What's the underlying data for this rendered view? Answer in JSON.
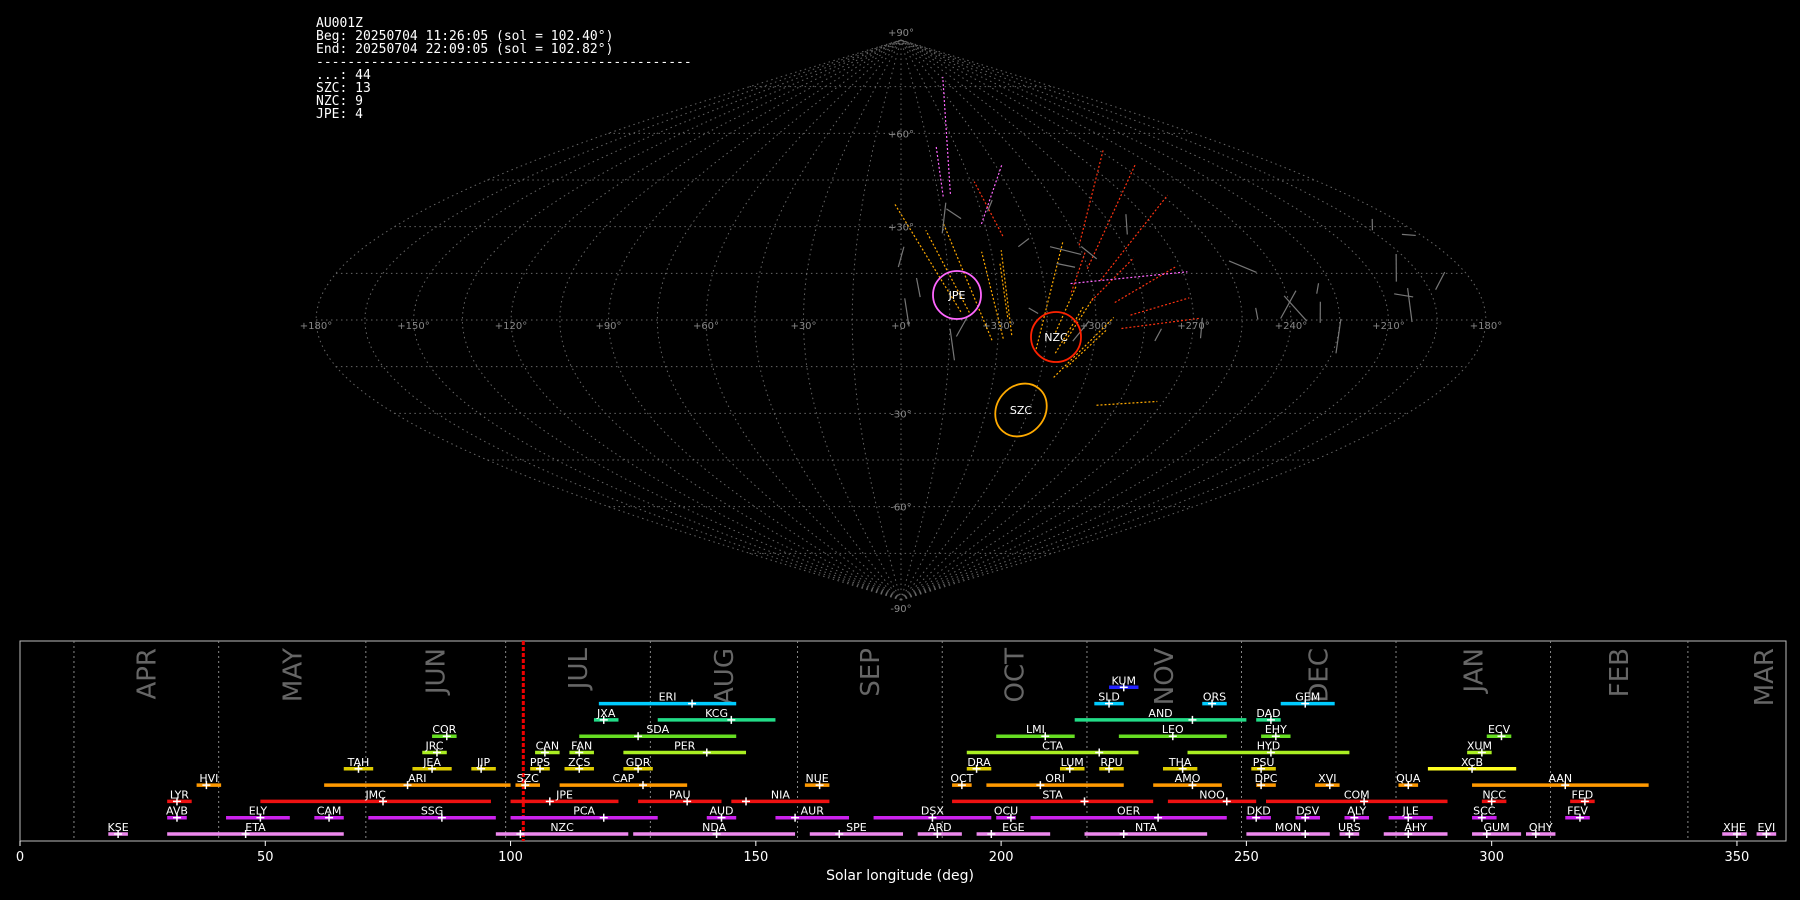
{
  "info": {
    "line1": "AU001Z",
    "line2": "Beg: 20250704 11:26:05 (sol = 102.40°)",
    "line3": "End: 20250704 22:09:05 (sol = 102.82°)",
    "separator": "------------------------------------------------",
    "counts": [
      {
        "label": "...",
        "value": 44
      },
      {
        "label": "SZC",
        "value": 13
      },
      {
        "label": "NZC",
        "value": 9
      },
      {
        "label": "JPE",
        "value": 4
      }
    ]
  },
  "sky": {
    "lon_labels": [
      "+180°",
      "+150°",
      "+120°",
      "+90°",
      "+60°",
      "+30°",
      "+0°",
      "+330°",
      "+300°",
      "+270°",
      "+240°",
      "+210°",
      "+180°"
    ],
    "lat_labels": [
      "+90°",
      "+60°",
      "+30°",
      "-30°",
      "-60°",
      "-90°"
    ],
    "radiants": [
      {
        "code": "JPE",
        "color": "#ff66ff"
      },
      {
        "code": "NZC",
        "color": "#ff2200"
      },
      {
        "code": "SZC",
        "color": "#ffaa00"
      }
    ]
  },
  "chart_data": {
    "type": "timeline",
    "xlabel": "Solar longitude (deg)",
    "xlim": [
      0,
      360
    ],
    "x_ticks": [
      0,
      50,
      100,
      150,
      200,
      250,
      300,
      350
    ],
    "current_sol": 102.6,
    "months": [
      {
        "name": "APR",
        "start": 11,
        "end": 40.5
      },
      {
        "name": "MAY",
        "start": 40.5,
        "end": 70.5
      },
      {
        "name": "JUN",
        "start": 70.5,
        "end": 99
      },
      {
        "name": "JUL",
        "start": 99,
        "end": 128.5
      },
      {
        "name": "AUG",
        "start": 128.5,
        "end": 158.5
      },
      {
        "name": "SEP",
        "start": 158.5,
        "end": 188
      },
      {
        "name": "OCT",
        "start": 188,
        "end": 217.5
      },
      {
        "name": "NOV",
        "start": 217.5,
        "end": 249
      },
      {
        "name": "DEC",
        "start": 249,
        "end": 280.5
      },
      {
        "name": "JAN",
        "start": 280.5,
        "end": 312
      },
      {
        "name": "FEB",
        "start": 312,
        "end": 340
      },
      {
        "name": "MAR",
        "start": 340,
        "end": 371
      }
    ],
    "showers": [
      {
        "code": "KUM",
        "start": 222,
        "end": 228,
        "peak": 225,
        "row": 10,
        "color": "#2222ff"
      },
      {
        "code": "ERI",
        "start": 118,
        "end": 146,
        "peak": 137,
        "row": 9,
        "color": "#00ccff"
      },
      {
        "code": "SLD",
        "start": 219,
        "end": 225,
        "peak": 222,
        "row": 9,
        "color": "#00ccff"
      },
      {
        "code": "ORS",
        "start": 241,
        "end": 246,
        "peak": 243,
        "row": 9,
        "color": "#00ccff"
      },
      {
        "code": "GEM",
        "start": 257,
        "end": 268,
        "peak": 262,
        "row": 9,
        "color": "#00ccff"
      },
      {
        "code": "JXA",
        "start": 117,
        "end": 122,
        "peak": 119,
        "row": 8,
        "color": "#22dd88"
      },
      {
        "code": "KCG",
        "start": 130,
        "end": 154,
        "peak": 145,
        "row": 8,
        "color": "#22dd88"
      },
      {
        "code": "AND",
        "start": 215,
        "end": 250,
        "peak": 239,
        "row": 8,
        "color": "#22dd88"
      },
      {
        "code": "DAD",
        "start": 252,
        "end": 257,
        "peak": 255,
        "row": 8,
        "color": "#22dd88"
      },
      {
        "code": "COR",
        "start": 84,
        "end": 89,
        "peak": 87,
        "row": 7,
        "color": "#66dd22"
      },
      {
        "code": "SDA",
        "start": 114,
        "end": 146,
        "peak": 126,
        "row": 7,
        "color": "#66dd22"
      },
      {
        "code": "LMI",
        "start": 199,
        "end": 215,
        "peak": 209,
        "row": 7,
        "color": "#66dd22"
      },
      {
        "code": "LEO",
        "start": 224,
        "end": 246,
        "peak": 235,
        "row": 7,
        "color": "#66dd22"
      },
      {
        "code": "EHY",
        "start": 253,
        "end": 259,
        "peak": 256,
        "row": 7,
        "color": "#66dd22"
      },
      {
        "code": "ECV",
        "start": 299,
        "end": 304,
        "peak": 302,
        "row": 7,
        "color": "#66dd22"
      },
      {
        "code": "JRC",
        "start": 82,
        "end": 87,
        "peak": 85,
        "row": 6,
        "color": "#aaee22"
      },
      {
        "code": "CAN",
        "start": 105,
        "end": 110,
        "peak": 107,
        "row": 6,
        "color": "#aaee22"
      },
      {
        "code": "FAN",
        "start": 112,
        "end": 117,
        "peak": 114,
        "row": 6,
        "color": "#aaee22"
      },
      {
        "code": "PER",
        "start": 123,
        "end": 148,
        "peak": 140,
        "row": 6,
        "color": "#aaee22"
      },
      {
        "code": "CTA",
        "start": 193,
        "end": 228,
        "peak": 220,
        "row": 6,
        "color": "#aaee22"
      },
      {
        "code": "HYD",
        "start": 238,
        "end": 271,
        "peak": 255,
        "row": 6,
        "color": "#aaee22"
      },
      {
        "code": "XUM",
        "start": 295,
        "end": 300,
        "peak": 298,
        "row": 6,
        "color": "#aaee22"
      },
      {
        "code": "TAH",
        "start": 66,
        "end": 72,
        "peak": 69,
        "row": 5,
        "color": "#ddcc00"
      },
      {
        "code": "JEA",
        "start": 80,
        "end": 88,
        "peak": 84,
        "row": 5,
        "color": "#ddcc00"
      },
      {
        "code": "JIP",
        "start": 92,
        "end": 97,
        "peak": 94,
        "row": 5,
        "color": "#ddcc00"
      },
      {
        "code": "PPS",
        "start": 104,
        "end": 108,
        "peak": 106,
        "row": 5,
        "color": "#ddcc00"
      },
      {
        "code": "ZCS",
        "start": 111,
        "end": 117,
        "peak": 114,
        "row": 5,
        "color": "#ddcc00"
      },
      {
        "code": "GDR",
        "start": 123,
        "end": 129,
        "peak": 126,
        "row": 5,
        "color": "#ddcc00"
      },
      {
        "code": "DRA",
        "start": 193,
        "end": 198,
        "peak": 195,
        "row": 5,
        "color": "#ddcc00"
      },
      {
        "code": "LUM",
        "start": 212,
        "end": 217,
        "peak": 214,
        "row": 5,
        "color": "#ddcc00"
      },
      {
        "code": "RPU",
        "start": 220,
        "end": 225,
        "peak": 222,
        "row": 5,
        "color": "#ddcc00"
      },
      {
        "code": "THA",
        "start": 233,
        "end": 240,
        "peak": 237,
        "row": 5,
        "color": "#ddcc00"
      },
      {
        "code": "PSU",
        "start": 251,
        "end": 256,
        "peak": 253,
        "row": 5,
        "color": "#ddcc00"
      },
      {
        "code": "XCB",
        "start": 287,
        "end": 305,
        "peak": 296,
        "row": 5,
        "color": "#ffff22"
      },
      {
        "code": "HVI",
        "start": 36,
        "end": 41,
        "peak": 38,
        "row": 4,
        "color": "#ff9900"
      },
      {
        "code": "ARI",
        "start": 62,
        "end": 100,
        "peak": 79,
        "row": 4,
        "color": "#ff9900"
      },
      {
        "code": "SZC",
        "start": 101,
        "end": 106,
        "peak": 103,
        "row": 4,
        "color": "#ff9900"
      },
      {
        "code": "CAP",
        "start": 110,
        "end": 136,
        "peak": 127,
        "row": 4,
        "color": "#ff9900"
      },
      {
        "code": "NUE",
        "start": 160,
        "end": 165,
        "peak": 163,
        "row": 4,
        "color": "#ff9900"
      },
      {
        "code": "OCT",
        "start": 190,
        "end": 194,
        "peak": 192,
        "row": 4,
        "color": "#ff9900"
      },
      {
        "code": "ORI",
        "start": 197,
        "end": 225,
        "peak": 208,
        "row": 4,
        "color": "#ff9900"
      },
      {
        "code": "AMO",
        "start": 231,
        "end": 245,
        "peak": 239,
        "row": 4,
        "color": "#ff9900"
      },
      {
        "code": "DPC",
        "start": 252,
        "end": 256,
        "peak": 253,
        "row": 4,
        "color": "#ff9900"
      },
      {
        "code": "XVI",
        "start": 264,
        "end": 269,
        "peak": 267,
        "row": 4,
        "color": "#ff9900"
      },
      {
        "code": "QUA",
        "start": 281,
        "end": 285,
        "peak": 283,
        "row": 4,
        "color": "#ff9900"
      },
      {
        "code": "AAN",
        "start": 296,
        "end": 332,
        "peak": 315,
        "row": 4,
        "color": "#ff9900"
      },
      {
        "code": "LYR",
        "start": 30,
        "end": 35,
        "peak": 32,
        "row": 3,
        "color": "#ee1111"
      },
      {
        "code": "JMC",
        "start": 49,
        "end": 96,
        "peak": 74,
        "row": 3,
        "color": "#ee1111"
      },
      {
        "code": "JPE",
        "start": 100,
        "end": 122,
        "peak": 108,
        "row": 3,
        "color": "#ee1111"
      },
      {
        "code": "PAU",
        "start": 126,
        "end": 143,
        "peak": 136,
        "row": 3,
        "color": "#ee1111"
      },
      {
        "code": "NIA",
        "start": 145,
        "end": 165,
        "peak": 148,
        "row": 3,
        "color": "#ee1111"
      },
      {
        "code": "STA",
        "start": 190,
        "end": 231,
        "peak": 217,
        "row": 3,
        "color": "#ee1111"
      },
      {
        "code": "NOO",
        "start": 234,
        "end": 252,
        "peak": 246,
        "row": 3,
        "color": "#ee1111"
      },
      {
        "code": "COM",
        "start": 254,
        "end": 291,
        "peak": 274,
        "row": 3,
        "color": "#ee1111"
      },
      {
        "code": "NCC",
        "start": 298,
        "end": 303,
        "peak": 300,
        "row": 3,
        "color": "#ee1111"
      },
      {
        "code": "FED",
        "start": 316,
        "end": 321,
        "peak": 319,
        "row": 3,
        "color": "#ee1111"
      },
      {
        "code": "AVB",
        "start": 30,
        "end": 34,
        "peak": 32,
        "row": 2,
        "color": "#cc22ee"
      },
      {
        "code": "ELY",
        "start": 42,
        "end": 55,
        "peak": 49,
        "row": 2,
        "color": "#cc22ee"
      },
      {
        "code": "CAM",
        "start": 60,
        "end": 66,
        "peak": 63,
        "row": 2,
        "color": "#cc22ee"
      },
      {
        "code": "SSG",
        "start": 71,
        "end": 97,
        "peak": 86,
        "row": 2,
        "color": "#cc22ee"
      },
      {
        "code": "PCA",
        "start": 100,
        "end": 130,
        "peak": 119,
        "row": 2,
        "color": "#cc22ee"
      },
      {
        "code": "AUD",
        "start": 140,
        "end": 146,
        "peak": 143,
        "row": 2,
        "color": "#cc22ee"
      },
      {
        "code": "AUR",
        "start": 154,
        "end": 169,
        "peak": 158,
        "row": 2,
        "color": "#cc22ee"
      },
      {
        "code": "DSX",
        "start": 174,
        "end": 198,
        "peak": 186,
        "row": 2,
        "color": "#cc22ee"
      },
      {
        "code": "OCU",
        "start": 199,
        "end": 203,
        "peak": 202,
        "row": 2,
        "color": "#cc22ee"
      },
      {
        "code": "OER",
        "start": 206,
        "end": 246,
        "peak": 232,
        "row": 2,
        "color": "#cc22ee"
      },
      {
        "code": "DKD",
        "start": 250,
        "end": 255,
        "peak": 252,
        "row": 2,
        "color": "#cc22ee"
      },
      {
        "code": "DSV",
        "start": 260,
        "end": 265,
        "peak": 262,
        "row": 2,
        "color": "#cc22ee"
      },
      {
        "code": "ALY",
        "start": 270,
        "end": 275,
        "peak": 272,
        "row": 2,
        "color": "#cc22ee"
      },
      {
        "code": "JLE",
        "start": 279,
        "end": 288,
        "peak": 283,
        "row": 2,
        "color": "#cc22ee"
      },
      {
        "code": "SCC",
        "start": 296,
        "end": 301,
        "peak": 298,
        "row": 2,
        "color": "#cc22ee"
      },
      {
        "code": "FEV",
        "start": 315,
        "end": 320,
        "peak": 318,
        "row": 2,
        "color": "#cc22ee"
      },
      {
        "code": "KSE",
        "start": 18,
        "end": 22,
        "peak": 20,
        "row": 1,
        "color": "#ee88ee"
      },
      {
        "code": "ETA",
        "start": 30,
        "end": 66,
        "peak": 46,
        "row": 1,
        "color": "#ee88ee"
      },
      {
        "code": "NZC",
        "start": 97,
        "end": 124,
        "peak": 102,
        "row": 1,
        "color": "#ee88ee"
      },
      {
        "code": "NDA",
        "start": 125,
        "end": 158,
        "peak": 142,
        "row": 1,
        "color": "#ee88ee"
      },
      {
        "code": "SPE",
        "start": 161,
        "end": 180,
        "peak": 167,
        "row": 1,
        "color": "#ee88ee"
      },
      {
        "code": "ARD",
        "start": 183,
        "end": 192,
        "peak": 187,
        "row": 1,
        "color": "#ee88ee"
      },
      {
        "code": "EGE",
        "start": 195,
        "end": 210,
        "peak": 198,
        "row": 1,
        "color": "#ee88ee"
      },
      {
        "code": "NTA",
        "start": 217,
        "end": 242,
        "peak": 225,
        "row": 1,
        "color": "#ee88ee"
      },
      {
        "code": "MON",
        "start": 250,
        "end": 267,
        "peak": 262,
        "row": 1,
        "color": "#ee88ee"
      },
      {
        "code": "URS",
        "start": 269,
        "end": 273,
        "peak": 271,
        "row": 1,
        "color": "#ee88ee"
      },
      {
        "code": "AHY",
        "start": 278,
        "end": 291,
        "peak": 283,
        "row": 1,
        "color": "#ee88ee"
      },
      {
        "code": "GUM",
        "start": 296,
        "end": 306,
        "peak": 299,
        "row": 1,
        "color": "#ee88ee"
      },
      {
        "code": "OHY",
        "start": 307,
        "end": 313,
        "peak": 309,
        "row": 1,
        "color": "#ee88ee"
      },
      {
        "code": "XHE",
        "start": 347,
        "end": 352,
        "peak": 350,
        "row": 1,
        "color": "#ee88ee"
      },
      {
        "code": "EVI",
        "start": 354,
        "end": 358,
        "peak": 356,
        "row": 1,
        "color": "#ee88ee"
      }
    ]
  }
}
